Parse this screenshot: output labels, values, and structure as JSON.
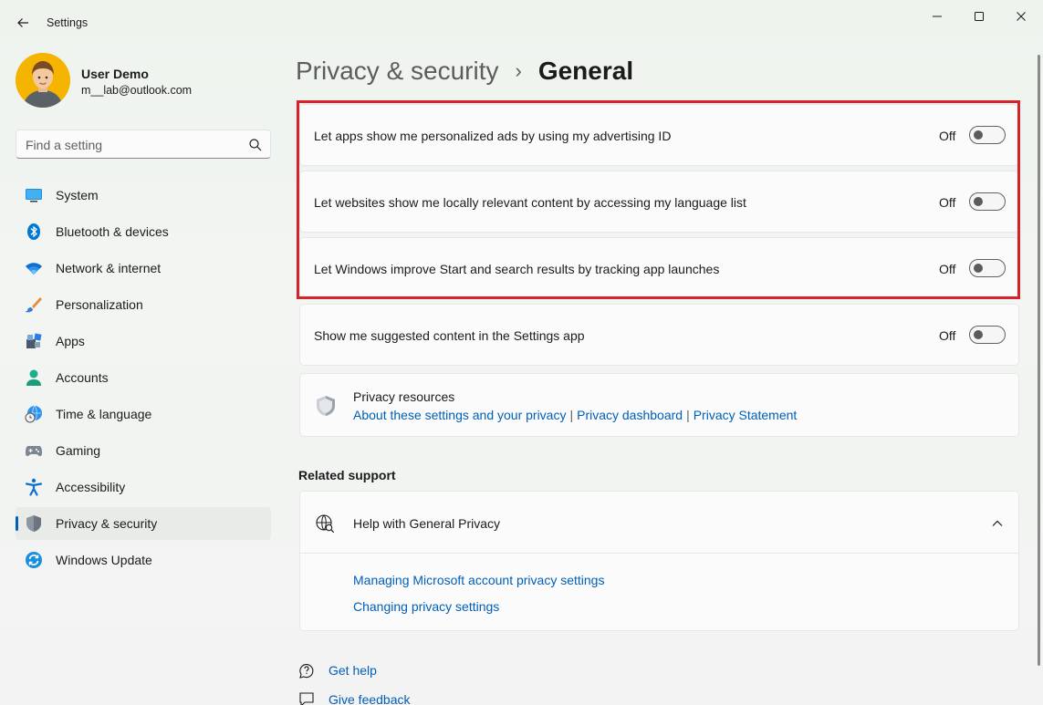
{
  "window": {
    "title": "Settings"
  },
  "user": {
    "name": "User Demo",
    "email": "m__lab@outlook.com"
  },
  "search": {
    "placeholder": "Find a setting"
  },
  "sidebar": {
    "items": [
      {
        "label": "System",
        "icon": "system-icon"
      },
      {
        "label": "Bluetooth & devices",
        "icon": "bluetooth-icon"
      },
      {
        "label": "Network & internet",
        "icon": "wifi-icon"
      },
      {
        "label": "Personalization",
        "icon": "brush-icon"
      },
      {
        "label": "Apps",
        "icon": "apps-icon"
      },
      {
        "label": "Accounts",
        "icon": "person-icon"
      },
      {
        "label": "Time & language",
        "icon": "globe-clock-icon"
      },
      {
        "label": "Gaming",
        "icon": "gamepad-icon"
      },
      {
        "label": "Accessibility",
        "icon": "accessibility-icon"
      },
      {
        "label": "Privacy & security",
        "icon": "shield-icon",
        "active": true
      },
      {
        "label": "Windows Update",
        "icon": "update-icon"
      }
    ]
  },
  "breadcrumb": {
    "parent": "Privacy & security",
    "separator": "›",
    "current": "General"
  },
  "settings": [
    {
      "label": "Let apps show me personalized ads by using my advertising ID",
      "state": "Off",
      "on": false
    },
    {
      "label": "Let websites show me locally relevant content by accessing my language list",
      "state": "Off",
      "on": false
    },
    {
      "label": "Let Windows improve Start and search results by tracking app launches",
      "state": "Off",
      "on": false
    },
    {
      "label": "Show me suggested content in the Settings app",
      "state": "Off",
      "on": false
    }
  ],
  "privacy_resources": {
    "title": "Privacy resources",
    "links": [
      "About these settings and your privacy",
      "Privacy dashboard",
      "Privacy Statement"
    ],
    "separator": "|"
  },
  "related_support": {
    "heading": "Related support",
    "help_title": "Help with General Privacy",
    "links": [
      "Managing Microsoft account privacy settings",
      "Changing privacy settings"
    ]
  },
  "footer": {
    "get_help": "Get help",
    "give_feedback": "Give feedback"
  },
  "colors": {
    "accent": "#005fb8",
    "highlight_border": "#d7222a"
  }
}
